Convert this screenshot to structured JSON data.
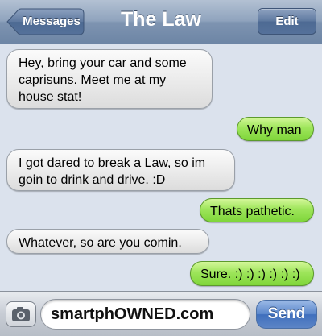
{
  "nav": {
    "back_label": "Messages",
    "title": "The Law",
    "edit_label": "Edit"
  },
  "messages": [
    {
      "direction": "incoming",
      "text": "Hey, bring your car and some caprisuns. Meet me at my house stat!"
    },
    {
      "direction": "outgoing",
      "text": "Why man"
    },
    {
      "direction": "incoming",
      "text": "I got dared to break a Law, so im goin to drink and drive. :D"
    },
    {
      "direction": "outgoing",
      "text": "Thats pathetic."
    },
    {
      "direction": "incoming",
      "text": "Whatever, so are you comin."
    },
    {
      "direction": "outgoing",
      "text": "Sure. :) :) :) :) :) :)"
    }
  ],
  "input": {
    "camera_icon": "camera-icon",
    "value": "smartphOWNED.com",
    "send_label": "Send"
  },
  "colors": {
    "navbar": "#8fa3bd",
    "incoming_bubble": "#e9e9e9",
    "outgoing_bubble": "#9ee55b",
    "send_button": "#5b87cb",
    "background": "#dbe2ed"
  }
}
